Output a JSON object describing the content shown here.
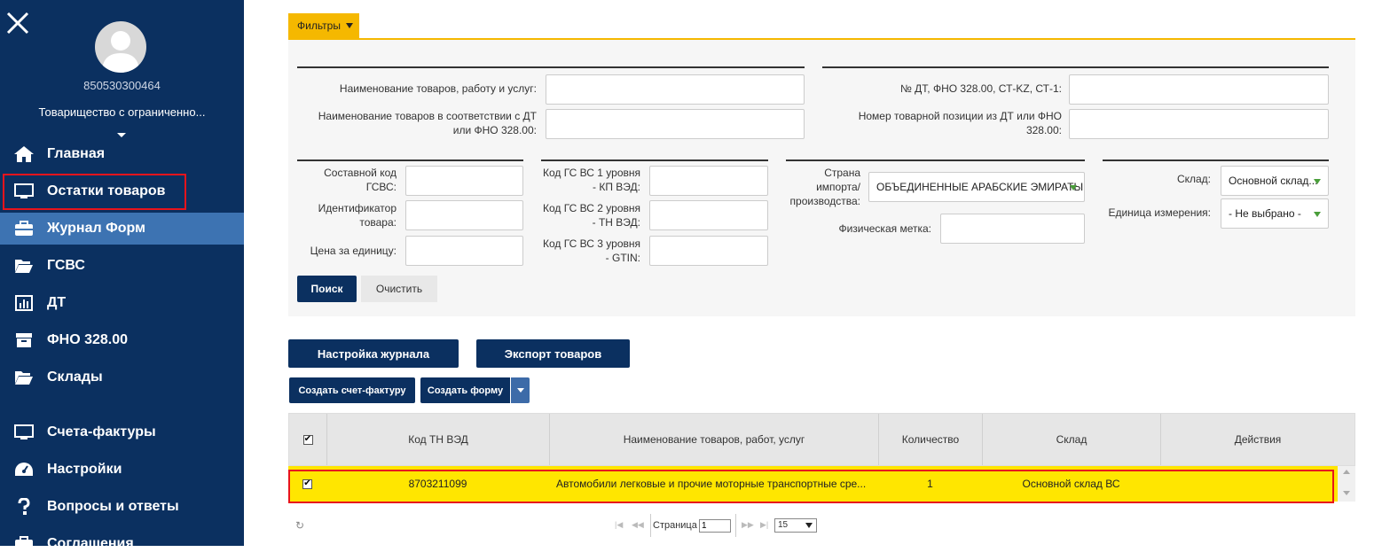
{
  "sidebar": {
    "user_id": "850530300464",
    "company": "Товарищество с ограниченно...",
    "items": [
      {
        "label": "Главная",
        "icon": "home-icon"
      },
      {
        "label": "Остатки товаров",
        "icon": "monitor-icon"
      },
      {
        "label": "Журнал Форм",
        "icon": "briefcase-icon"
      },
      {
        "label": "ГСВС",
        "icon": "folder-open-icon"
      },
      {
        "label": "ДТ",
        "icon": "bar-chart-icon"
      },
      {
        "label": "ФНО 328.00",
        "icon": "archive-icon"
      },
      {
        "label": "Склады",
        "icon": "folder-open-icon"
      },
      {
        "label": "Счета-фактуры",
        "icon": "monitor-icon"
      },
      {
        "label": "Настройки",
        "icon": "dashboard-icon"
      },
      {
        "label": "Вопросы и ответы",
        "icon": "question-icon"
      },
      {
        "label": "Соглашения",
        "icon": "briefcase-icon"
      }
    ],
    "active_item": "Журнал Форм",
    "highlighted_item": "Остатки товаров"
  },
  "filters": {
    "tab_label": "Фильтры",
    "goods_name_label": "Наименование товаров, работу и услуг:",
    "goods_name_dt_label_1": "Наименование товаров в соответствии с ДТ",
    "goods_name_dt_label_2": "или ФНО 328.00:",
    "dt_number_label": "№ ДТ, ФНО 328.00, СТ-KZ, СТ-1:",
    "position_label_1": "Номер товарной позиции из ДТ или ФНО",
    "position_label_2": "328.00:",
    "composite_code_label_1": "Составной код",
    "composite_code_label_2": "ГСВС:",
    "identifier_label_1": "Идентификатор",
    "identifier_label_2": "товара:",
    "price_label": "Цена за единицу:",
    "level1_label_1": "Код ГС ВС 1 уровня",
    "level1_label_2": "- КП ВЭД:",
    "level2_label_1": "Код ГС ВС 2 уровня",
    "level2_label_2": "- ТН ВЭД:",
    "level3_label_1": "Код ГС ВС 3 уровня",
    "level3_label_2": "- GTIN:",
    "country_label_1": "Страна",
    "country_label_2": "импорта/",
    "country_label_3": "производства:",
    "country_value": "ОБЪЕДИНЕННЫЕ АРАБСКИЕ ЭМИРАТЫ",
    "physical_mark_label": "Физическая метка:",
    "warehouse_label": "Склад:",
    "warehouse_value": "Основной склад...",
    "unit_label": "Единица измерения:",
    "unit_value": "- Не выбрано -",
    "search_button": "Поиск",
    "clear_button": "Очистить"
  },
  "actions": {
    "journal_settings": "Настройка журнала",
    "export_goods": "Экспорт товаров",
    "create_invoice": "Создать счет-фактуру",
    "create_form": "Создать форму"
  },
  "table": {
    "columns": [
      "Код ТН ВЭД",
      "Наименование товаров, работ, услуг",
      "Количество",
      "Склад",
      "Действия"
    ],
    "rows": [
      {
        "code": "8703211099",
        "name": "Автомобили легковые и прочие моторные транспортные сре...",
        "quantity": "1",
        "warehouse": "Основной склад ВС",
        "checked": true
      }
    ]
  },
  "pager": {
    "page_label": "Страница",
    "page_value": "1",
    "page_size": "15"
  },
  "colors": {
    "sidebar_bg": "#0b3060",
    "active_bg": "#3d73b2",
    "accent": "#f5b800",
    "highlight_border": "#e8141c",
    "row_highlight": "#ffe600"
  }
}
